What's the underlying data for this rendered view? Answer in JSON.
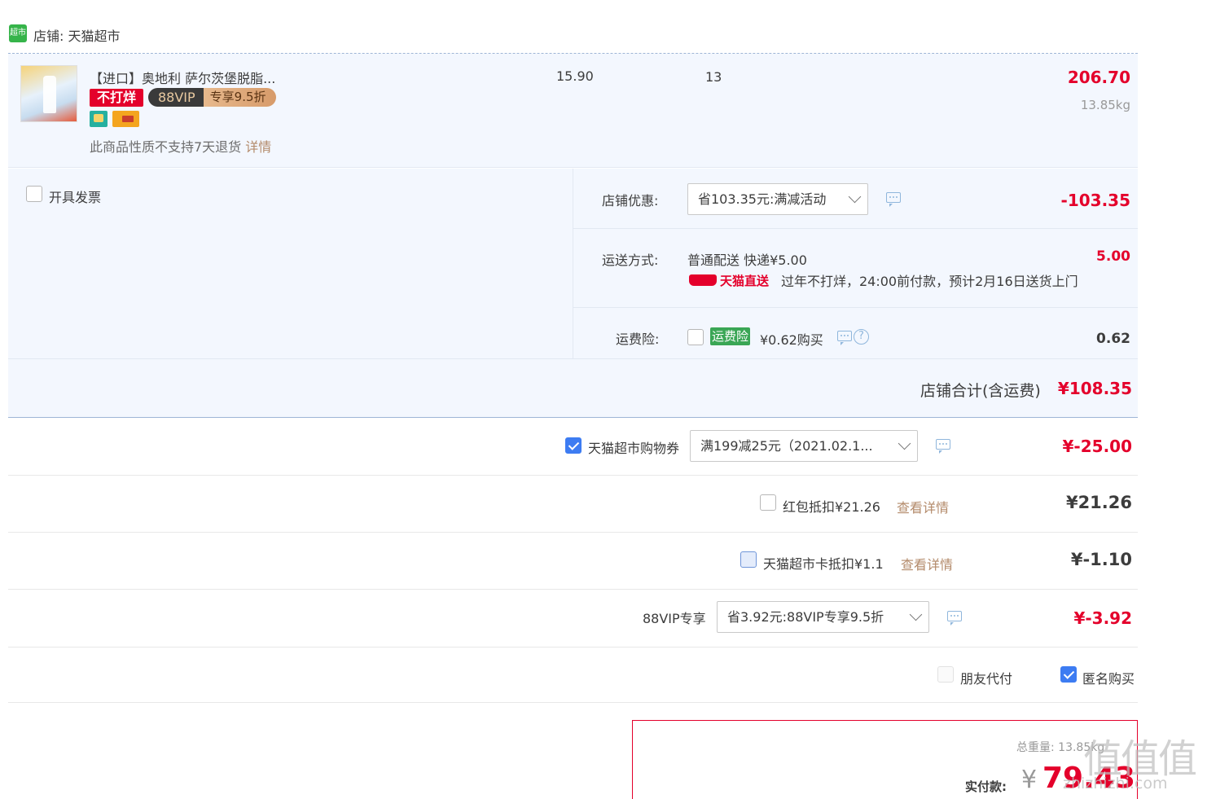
{
  "shop": {
    "logo_text": "超市",
    "label": "店铺: 天猫超市"
  },
  "item": {
    "title": "【进口】奥地利 萨尔茨堡脱脂...",
    "price": "15.90",
    "quantity": "13",
    "subtotal": "206.70",
    "weight": "13.85kg",
    "badge_tag": "不打烊",
    "vip_label": "88VIP",
    "vip_discount": "专享9.5折",
    "return_note": "此商品性质不支持7天退货",
    "return_link": "详情"
  },
  "invoice": {
    "label": "开具发票"
  },
  "shop_discount": {
    "label": "店铺优惠:",
    "selected": "省103.35元:满减活动",
    "amount": "-103.35"
  },
  "shipping": {
    "label": "运送方式:",
    "method": "普通配送 快递¥5.00",
    "brand": "天猫直送",
    "note": "过年不打烊，24:00前付款，预计2月16日送货上门",
    "amount": "5.00"
  },
  "insurance": {
    "label": "运费险:",
    "tag": "运费险",
    "price": "¥0.62购买",
    "amount": "0.62"
  },
  "shop_total": {
    "label": "店铺合计(含运费)",
    "amount": "¥108.35"
  },
  "coupon": {
    "label": "天猫超市购物券",
    "selected": "满199减25元（2021.02.1...",
    "amount": "¥-25.00"
  },
  "redpacket": {
    "label": "红包抵扣¥21.26",
    "link": "查看详情",
    "amount": "¥21.26"
  },
  "card": {
    "label": "天猫超市卡抵扣¥1.1",
    "link": "查看详情",
    "amount": "¥-1.10"
  },
  "vip88": {
    "label": "88VIP专享",
    "selected": "省3.92元:88VIP专享9.5折",
    "amount": "¥-3.92"
  },
  "options": {
    "friend_pay": "朋友代付",
    "anonymous": "匿名购买"
  },
  "summary": {
    "weight_label": "总重量:",
    "weight_value": "13.85kg",
    "pay_label": "实付款:",
    "currency": "¥",
    "pay_value": "79.43"
  },
  "watermark": {
    "brand": "值值值",
    "site": "zhizhizhi.com"
  },
  "colors": {
    "accent_red": "#e4002b",
    "check_blue": "#3d7cf2",
    "panel_bg": "#f3f7fe",
    "link_brown": "#b38a6a",
    "tmall_green": "#1aa34a"
  }
}
